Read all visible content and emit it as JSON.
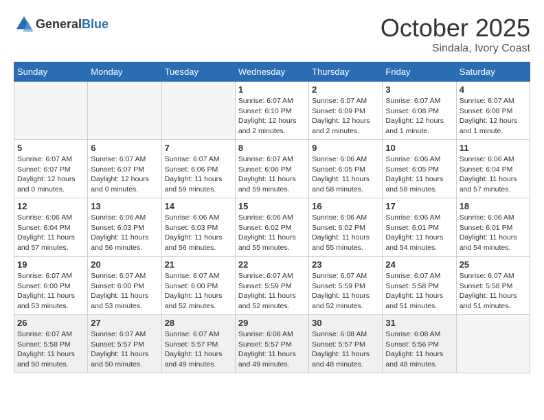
{
  "header": {
    "logo": {
      "general": "General",
      "blue": "Blue"
    },
    "month": "October 2025",
    "location": "Sindala, Ivory Coast"
  },
  "weekdays": [
    "Sunday",
    "Monday",
    "Tuesday",
    "Wednesday",
    "Thursday",
    "Friday",
    "Saturday"
  ],
  "weeks": [
    [
      {
        "day": "",
        "empty": true
      },
      {
        "day": "",
        "empty": true
      },
      {
        "day": "",
        "empty": true
      },
      {
        "day": "1",
        "sunrise": "6:07 AM",
        "sunset": "6:10 PM",
        "daylight": "12 hours and 2 minutes."
      },
      {
        "day": "2",
        "sunrise": "6:07 AM",
        "sunset": "6:09 PM",
        "daylight": "12 hours and 2 minutes."
      },
      {
        "day": "3",
        "sunrise": "6:07 AM",
        "sunset": "6:08 PM",
        "daylight": "12 hours and 1 minute."
      },
      {
        "day": "4",
        "sunrise": "6:07 AM",
        "sunset": "6:08 PM",
        "daylight": "12 hours and 1 minute."
      }
    ],
    [
      {
        "day": "5",
        "sunrise": "6:07 AM",
        "sunset": "6:07 PM",
        "daylight": "12 hours and 0 minutes."
      },
      {
        "day": "6",
        "sunrise": "6:07 AM",
        "sunset": "6:07 PM",
        "daylight": "12 hours and 0 minutes."
      },
      {
        "day": "7",
        "sunrise": "6:07 AM",
        "sunset": "6:06 PM",
        "daylight": "11 hours and 59 minutes."
      },
      {
        "day": "8",
        "sunrise": "6:07 AM",
        "sunset": "6:06 PM",
        "daylight": "11 hours and 59 minutes."
      },
      {
        "day": "9",
        "sunrise": "6:06 AM",
        "sunset": "6:05 PM",
        "daylight": "11 hours and 58 minutes."
      },
      {
        "day": "10",
        "sunrise": "6:06 AM",
        "sunset": "6:05 PM",
        "daylight": "11 hours and 58 minutes."
      },
      {
        "day": "11",
        "sunrise": "6:06 AM",
        "sunset": "6:04 PM",
        "daylight": "11 hours and 57 minutes."
      }
    ],
    [
      {
        "day": "12",
        "sunrise": "6:06 AM",
        "sunset": "6:04 PM",
        "daylight": "11 hours and 57 minutes."
      },
      {
        "day": "13",
        "sunrise": "6:06 AM",
        "sunset": "6:03 PM",
        "daylight": "11 hours and 56 minutes."
      },
      {
        "day": "14",
        "sunrise": "6:06 AM",
        "sunset": "6:03 PM",
        "daylight": "11 hours and 56 minutes."
      },
      {
        "day": "15",
        "sunrise": "6:06 AM",
        "sunset": "6:02 PM",
        "daylight": "11 hours and 55 minutes."
      },
      {
        "day": "16",
        "sunrise": "6:06 AM",
        "sunset": "6:02 PM",
        "daylight": "11 hours and 55 minutes."
      },
      {
        "day": "17",
        "sunrise": "6:06 AM",
        "sunset": "6:01 PM",
        "daylight": "11 hours and 54 minutes."
      },
      {
        "day": "18",
        "sunrise": "6:06 AM",
        "sunset": "6:01 PM",
        "daylight": "11 hours and 54 minutes."
      }
    ],
    [
      {
        "day": "19",
        "sunrise": "6:07 AM",
        "sunset": "6:00 PM",
        "daylight": "11 hours and 53 minutes."
      },
      {
        "day": "20",
        "sunrise": "6:07 AM",
        "sunset": "6:00 PM",
        "daylight": "11 hours and 53 minutes."
      },
      {
        "day": "21",
        "sunrise": "6:07 AM",
        "sunset": "6:00 PM",
        "daylight": "11 hours and 52 minutes."
      },
      {
        "day": "22",
        "sunrise": "6:07 AM",
        "sunset": "5:59 PM",
        "daylight": "11 hours and 52 minutes."
      },
      {
        "day": "23",
        "sunrise": "6:07 AM",
        "sunset": "5:59 PM",
        "daylight": "11 hours and 52 minutes."
      },
      {
        "day": "24",
        "sunrise": "6:07 AM",
        "sunset": "5:58 PM",
        "daylight": "11 hours and 51 minutes."
      },
      {
        "day": "25",
        "sunrise": "6:07 AM",
        "sunset": "5:58 PM",
        "daylight": "11 hours and 51 minutes."
      }
    ],
    [
      {
        "day": "26",
        "sunrise": "6:07 AM",
        "sunset": "5:58 PM",
        "daylight": "11 hours and 50 minutes."
      },
      {
        "day": "27",
        "sunrise": "6:07 AM",
        "sunset": "5:57 PM",
        "daylight": "11 hours and 50 minutes."
      },
      {
        "day": "28",
        "sunrise": "6:07 AM",
        "sunset": "5:57 PM",
        "daylight": "11 hours and 49 minutes."
      },
      {
        "day": "29",
        "sunrise": "6:08 AM",
        "sunset": "5:57 PM",
        "daylight": "11 hours and 49 minutes."
      },
      {
        "day": "30",
        "sunrise": "6:08 AM",
        "sunset": "5:57 PM",
        "daylight": "11 hours and 48 minutes."
      },
      {
        "day": "31",
        "sunrise": "6:08 AM",
        "sunset": "5:56 PM",
        "daylight": "11 hours and 48 minutes."
      },
      {
        "day": "",
        "empty": true
      }
    ]
  ],
  "labels": {
    "sunrise": "Sunrise:",
    "sunset": "Sunset:",
    "daylight": "Daylight hours"
  }
}
